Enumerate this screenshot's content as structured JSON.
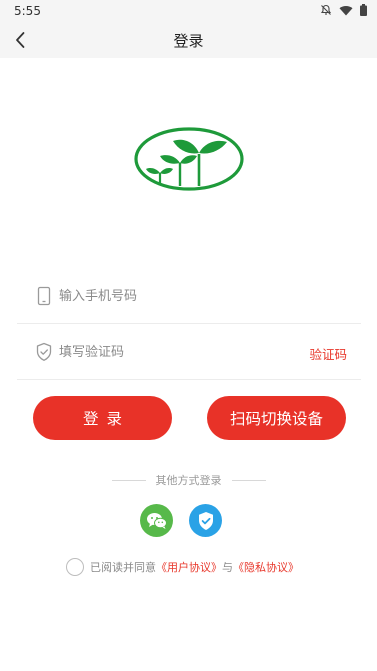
{
  "status_bar": {
    "time": "5:55",
    "icons": [
      "bell-off-icon",
      "wifi-icon",
      "battery-icon"
    ]
  },
  "header": {
    "title": "登录",
    "back_icon": "chevron-left-icon"
  },
  "colors": {
    "accent": "#e83228",
    "logo_green": "#1e9a3a",
    "wechat": "#57b94a",
    "verify": "#2aa2e6"
  },
  "form": {
    "phone": {
      "placeholder": "输入手机号码",
      "value": "",
      "icon": "phone-icon"
    },
    "code": {
      "placeholder": "填写验证码",
      "value": "",
      "icon": "shield-icon",
      "get_code_label": "验证码"
    }
  },
  "buttons": {
    "login_label": "登录",
    "scan_label": "扫码切换设备"
  },
  "other_login": {
    "label": "其他方式登录",
    "icons": [
      "wechat-icon",
      "verify-shield-icon"
    ]
  },
  "agreement": {
    "prefix": "已阅读并同意",
    "user_agreement": "《用户协议》",
    "and": "与",
    "privacy_agreement": "《隐私协议》"
  }
}
